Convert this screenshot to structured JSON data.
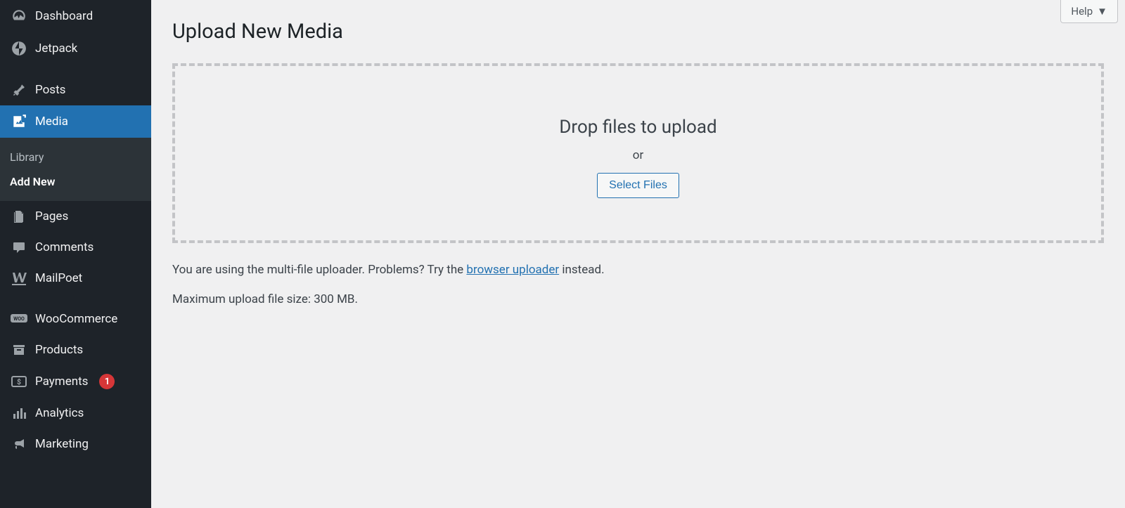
{
  "sidebar": {
    "dashboard": "Dashboard",
    "jetpack": "Jetpack",
    "posts": "Posts",
    "media": "Media",
    "media_sub": {
      "library": "Library",
      "add_new": "Add New"
    },
    "pages": "Pages",
    "comments": "Comments",
    "mailpoet": "MailPoet",
    "woocommerce": "WooCommerce",
    "products": "Products",
    "payments": "Payments",
    "payments_badge": "1",
    "analytics": "Analytics",
    "marketing": "Marketing"
  },
  "help_label": "Help",
  "page_title": "Upload New Media",
  "drop": {
    "instruction": "Drop files to upload",
    "or": "or",
    "select_btn": "Select Files"
  },
  "info": {
    "prefix": "You are using the multi-file uploader. Problems? Try the ",
    "link": "browser uploader",
    "suffix": " instead."
  },
  "max_size": "Maximum upload file size: 300 MB."
}
